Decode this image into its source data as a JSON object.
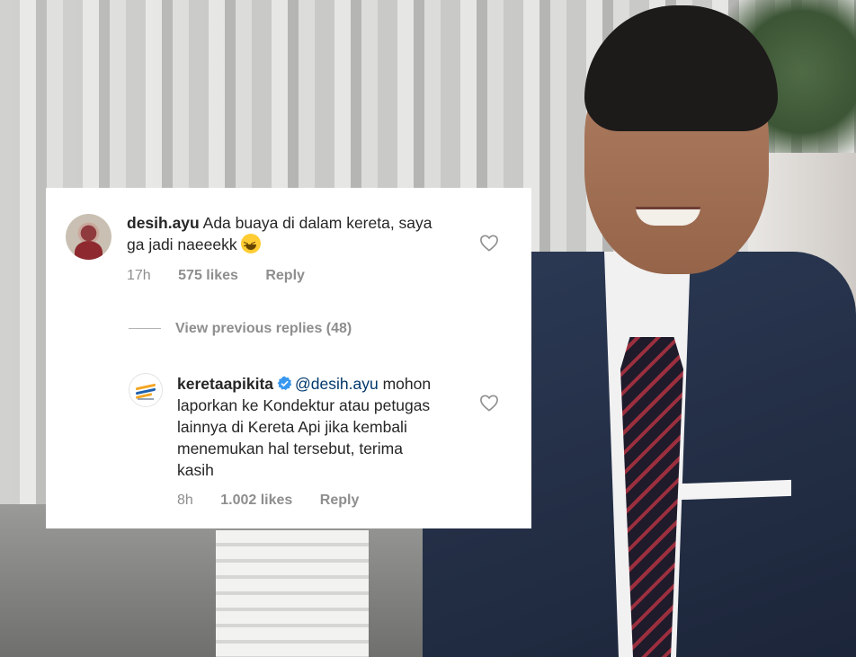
{
  "comment": {
    "username": "desih.ayu",
    "text": "Ada buaya di dalam kereta, saya ga jadi naeeekk",
    "emoji": "grinning-squinting-face",
    "time": "17h",
    "likes": "575 likes",
    "reply_label": "Reply"
  },
  "view_previous": "View previous replies (48)",
  "reply": {
    "username": "keretaapikita",
    "mention": "@desih.ayu",
    "text": "mohon laporkan ke Kondektur atau petugas lainnya di Kereta Api jika kembali menemukan hal tersebut, terima kasih",
    "time": "8h",
    "likes": "1.002 likes",
    "reply_label": "Reply"
  },
  "colors": {
    "text": "#262626",
    "meta": "#8e8e8e",
    "mention": "#00376b",
    "verified": "#3897f0"
  }
}
